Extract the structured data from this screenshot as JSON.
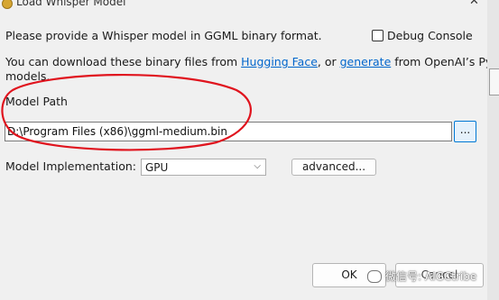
{
  "window": {
    "title": "Load Whisper Model"
  },
  "intro_text": "Please provide a Whisper model in GGML binary format.",
  "debug_console": {
    "label": "Debug Console",
    "checked": false
  },
  "download": {
    "prefix": "You can download these binary files from ",
    "link1": "Hugging Face",
    "middle": ", or ",
    "link2": "generate",
    "suffix": " from OpenAI’s Python",
    "line2": "models."
  },
  "model_path": {
    "label": "Model Path",
    "value": "D:\\Program Files (x86)\\ggml-medium.bin",
    "browse_label": "..."
  },
  "implementation": {
    "label": "Model Implementation:",
    "selected": "GPU",
    "advanced_label": "advanced..."
  },
  "buttons": {
    "ok": "OK",
    "cancel": "Cancel"
  },
  "watermark": {
    "text": "微信号: AIGCtribe"
  },
  "colors": {
    "link": "#0066cc",
    "annotation": "#e0141e",
    "focus": "#0078d4"
  }
}
